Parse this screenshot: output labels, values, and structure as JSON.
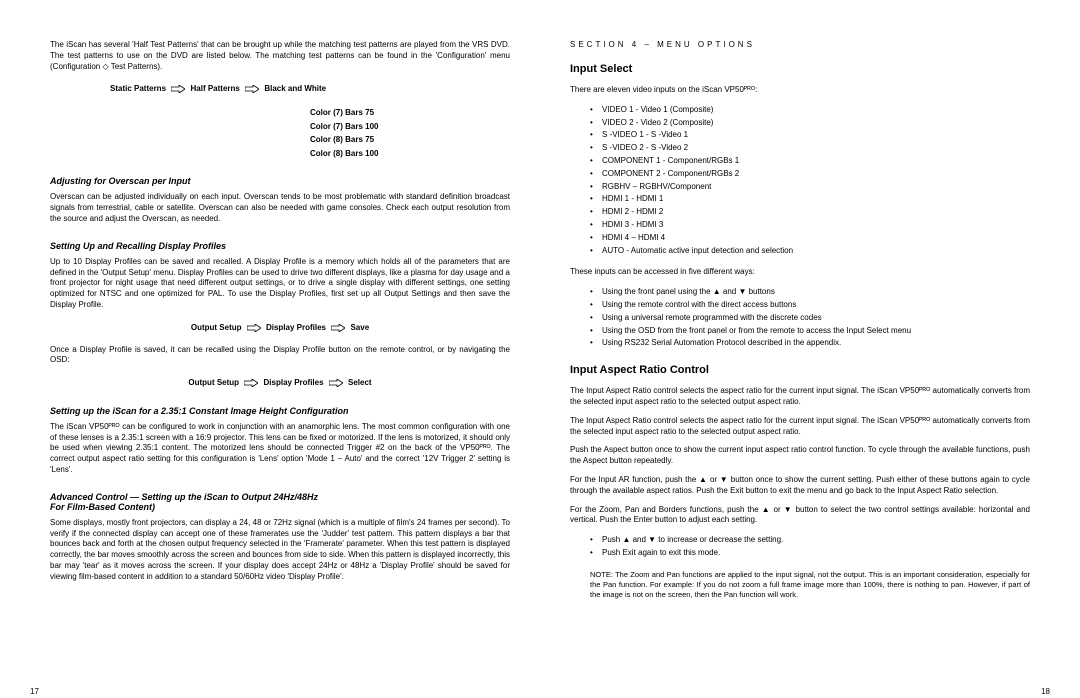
{
  "left": {
    "intro": "The iScan has several 'Half Test Patterns' that can be brought up while the matching test patterns are played from the VRS DVD. The test patterns to use on the DVD are listed below. The matching test patterns can be found in the 'Configuration' menu (Configuration ◇ Test Patterns).",
    "nav1_a": "Static Patterns",
    "nav1_b": "Half Patterns",
    "nav1_c": "Black and White",
    "patterns": [
      "Color (7) Bars 75",
      "Color (7) Bars 100",
      "Color (8) Bars 75",
      "Color (8) Bars 100"
    ],
    "h_overscan": "Adjusting for Overscan per Input",
    "p_overscan": "Overscan can be adjusted individually on each input. Overscan tends to be most problematic with standard definition broadcast signals from terrestrial, cable or satellite. Overscan can also be needed with game consoles. Check each output resolution from the source and adjust the Overscan, as needed.",
    "h_profiles": "Setting Up and Recalling Display Profiles",
    "p_profiles": "Up to 10 Display Profiles can be saved and recalled. A Display Profile is a memory which holds all of the parameters that are defined in the 'Output Setup' menu. Display Profiles can be used to drive two different displays, like a plasma for day usage and a front projector for night usage that need different output settings, or to drive a single display with different settings, one setting optimized for NTSC and one optimized for PAL. To use the Display Profiles, first set up all Output Settings and then save the Display Profile.",
    "nav2_a": "Output Setup",
    "nav2_b": "Display Profiles",
    "nav2_c": "Save",
    "p_profiles2": "Once a Display Profile is saved, it can be recalled using the Display Profile button on the remote control, or by navigating the OSD:",
    "nav3_a": "Output Setup",
    "nav3_b": "Display Profiles",
    "nav3_c": "Select",
    "h_235": "Setting up the iScan for a 2.35:1 Constant Image Height Configuration",
    "p_235": "The iScan VP50ᴾᴿᴼ can be configured to work in conjunction with an anamorphic lens. The most common configuration with one of these lenses is a 2.35:1 screen with a 16:9 projector. This lens can be fixed or motorized. If the lens is motorized, it should only be used when viewing 2.35:1 content. The motorized lens should be connected Trigger #2 on the back of the VP50ᴾᴿᴼ. The correct output aspect ratio setting for this configuration is 'Lens' option 'Mode 1 – Auto' and the correct '12V Trigger 2' setting is 'Lens'.",
    "h_adv": "Advanced Control — Setting up the iScan to Output 24Hz/48Hz",
    "h_adv2": "For Film-Based Content)",
    "p_adv": "Some displays, mostly front projectors, can display a 24, 48 or 72Hz signal (which is a multiple of film's 24 frames per second). To verify if the connected display can accept one of these framerates use the 'Judder' test pattern. This pattern displays a bar that bounces back and forth at the chosen output frequency selected in the 'Framerate' parameter. When this test pattern is displayed correctly, the bar moves smoothly across the screen and bounces from side to side. When this pattern is displayed incorrectly, this bar may 'tear' as it moves across the screen. If your display does accept 24Hz or 48Hz a 'Display Profile' should be saved for viewing film-based content in addition to a standard 50/60Hz video 'Display Profile'.",
    "pagenum": "17"
  },
  "right": {
    "section": "SECTION 4 – MENU OPTIONS",
    "h_input": "Input Select",
    "p_input": "There are eleven video inputs on the iScan VP50ᴾᴿᴼ:",
    "inputs": [
      "VIDEO 1 - Video 1 (Composite)",
      "VIDEO 2 - Video 2 (Composite)",
      "S -VIDEO 1 - S -Video 1",
      "S -VIDEO 2 - S -Video 2",
      "COMPONENT 1 - Component/RGBs 1",
      "COMPONENT 2 - Component/RGBs 2",
      "RGBHV – RGBHV/Component",
      "HDMI 1 - HDMI 1",
      "HDMI 2 - HDMI 2",
      "HDMI 3 - HDMI 3",
      "HDMI 4 – HDMI 4",
      "AUTO - Automatic active input detection and selection"
    ],
    "p_access": "These inputs can be accessed in five different ways:",
    "access": [
      "Using the front panel using the ▲ and ▼ buttons",
      "Using the remote control with the direct access buttons",
      "Using a universal remote programmed with the discrete codes",
      "Using the OSD from the front panel or from the remote to access the Input Select menu",
      "Using RS232 Serial Automation Protocol described in the appendix."
    ],
    "h_aspect": "Input Aspect Ratio Control",
    "p_aspect1": "The Input Aspect Ratio control selects the aspect ratio for the current input signal. The iScan VP50ᴾᴿᴼ automatically converts from the selected input aspect ratio to the selected output aspect ratio.",
    "p_aspect2": "The Input Aspect Ratio control selects the aspect ratio for the current input signal. The iScan VP50ᴾᴿᴼ automatically converts from the selected input aspect ratio to the selected output aspect ratio.",
    "p_aspect3": "Push the Aspect button once to show the current input aspect ratio control function. To cycle through the available functions, push the Aspect button repeatedly.",
    "p_aspect4": "For the Input AR function, push the ▲ or ▼ button once to show the current setting. Push either of these buttons again to cycle through the available aspect ratios. Push the Exit button to exit the menu and go back to the Input Aspect Ratio selection.",
    "p_aspect5": "For the Zoom, Pan and Borders functions, push the ▲ or ▼ button to select the two control settings available: horizontal and vertical. Push the Enter button to adjust each setting.",
    "controls": [
      "Push ▲ and ▼ to increase or decrease the setting.",
      "Push Exit again to exit this mode."
    ],
    "note": "NOTE: The Zoom and Pan functions are applied to the input signal, not the output. This is an important consideration, especially for the Pan function. For example: If you do not zoom a full frame image more than 100%, there is nothing to pan. However, if part of the image is not on the screen, then the Pan function will work.",
    "pagenum": "18"
  }
}
